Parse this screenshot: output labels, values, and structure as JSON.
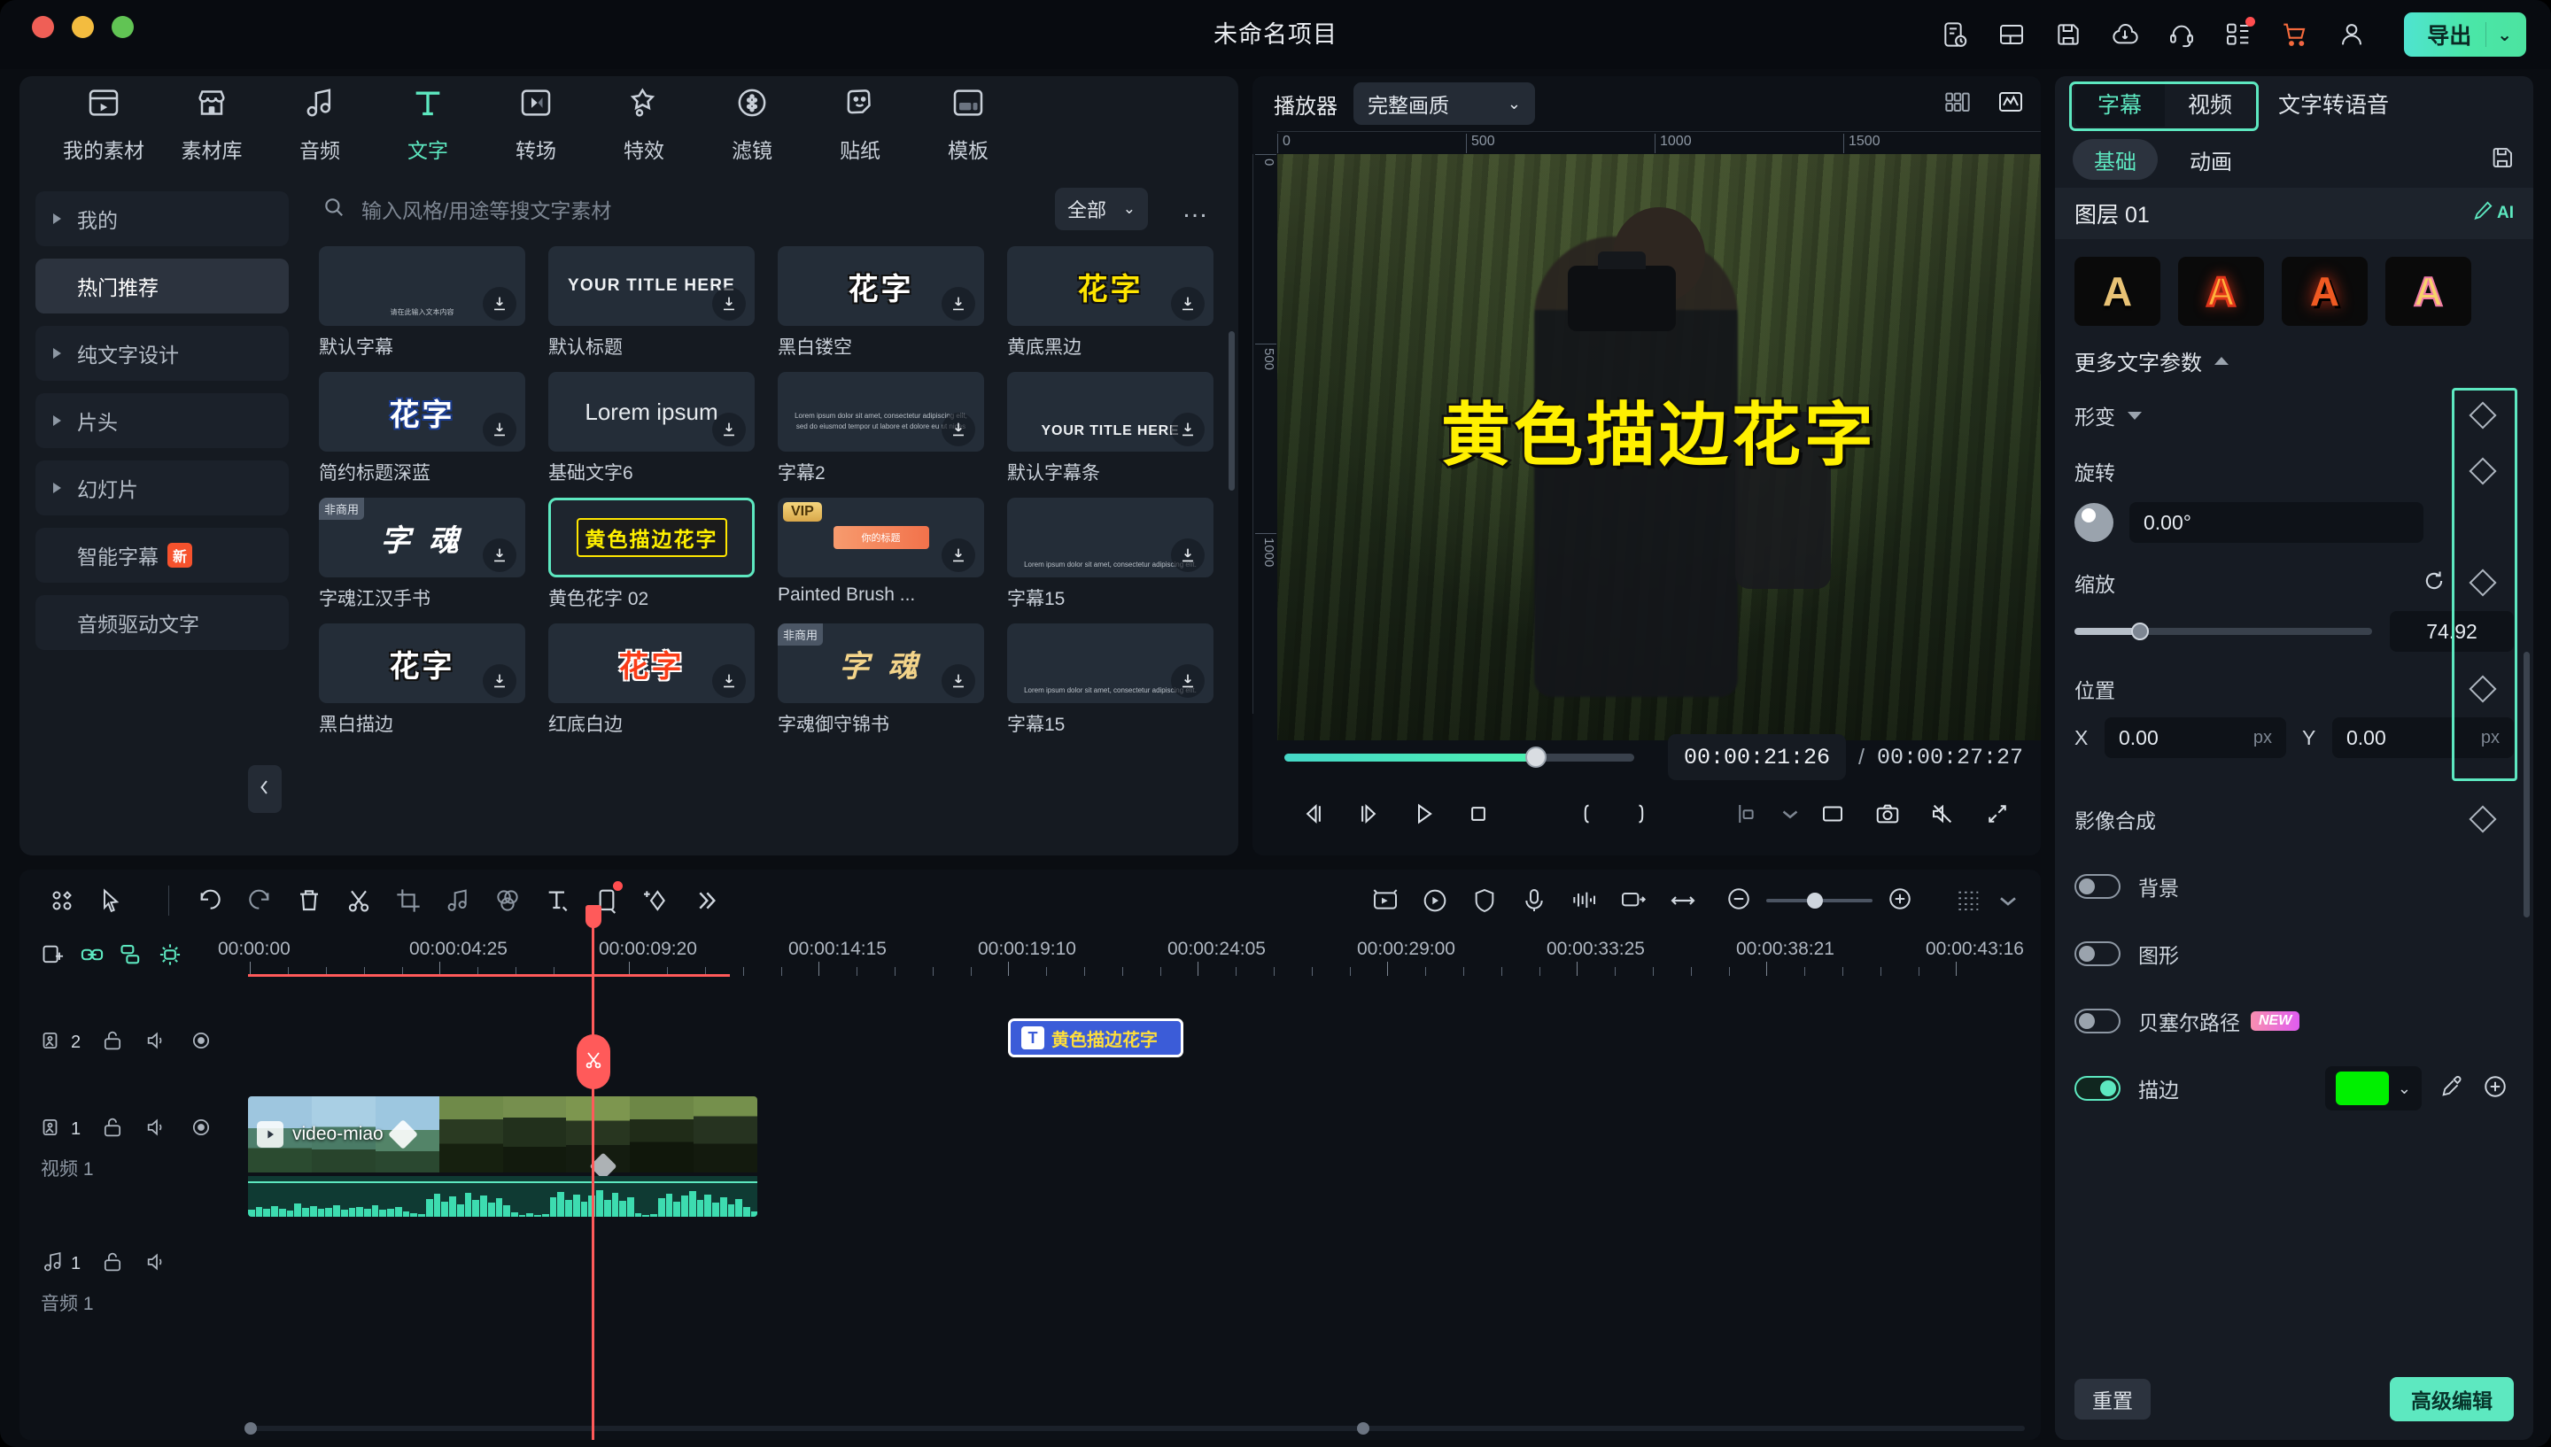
{
  "window": {
    "title": "未命名项目"
  },
  "topbar": {
    "icons": [
      "note-clock-icon",
      "layout-icon",
      "save-icon",
      "cloud-upload-icon",
      "headset-support-icon",
      "apps-grid-icon",
      "cart-icon",
      "account-icon"
    ],
    "export_label": "导出",
    "export_chevron": "chevron-down-icon"
  },
  "material_panel": {
    "tabs": [
      {
        "label": "我的素材",
        "icon": "my-media-icon",
        "active": false
      },
      {
        "label": "素材库",
        "icon": "store-icon",
        "active": false
      },
      {
        "label": "音频",
        "icon": "music-note-icon",
        "active": false
      },
      {
        "label": "文字",
        "icon": "text-t-icon",
        "active": true
      },
      {
        "label": "转场",
        "icon": "transition-icon",
        "active": false
      },
      {
        "label": "特效",
        "icon": "sparkle-star-icon",
        "active": false
      },
      {
        "label": "滤镜",
        "icon": "filter-circle-icon",
        "active": false
      },
      {
        "label": "贴纸",
        "icon": "sticker-smiley-icon",
        "active": false
      },
      {
        "label": "模板",
        "icon": "template-icon",
        "active": false
      }
    ],
    "sidebar": [
      {
        "label": "我的",
        "expandable": true,
        "active": false
      },
      {
        "label": "热门推荐",
        "expandable": false,
        "active": true
      },
      {
        "label": "纯文字设计",
        "expandable": true,
        "active": false
      },
      {
        "label": "片头",
        "expandable": true,
        "active": false
      },
      {
        "label": "幻灯片",
        "expandable": true,
        "active": false
      },
      {
        "label": "智能字幕",
        "expandable": false,
        "active": false,
        "badge": "新"
      },
      {
        "label": "音频驱动文字",
        "expandable": false,
        "active": false
      }
    ],
    "search": {
      "placeholder": "输入风格/用途等搜文字素材",
      "icon": "search-icon"
    },
    "filter": {
      "label": "全部",
      "icon": "chevron-down-icon"
    },
    "more": "…",
    "items": [
      {
        "name": "默认字幕",
        "style": "mini",
        "preview": "请在此输入文本内容"
      },
      {
        "name": "默认标题",
        "style": "title",
        "preview": "YOUR TITLE HERE"
      },
      {
        "name": "黑白镂空",
        "style": "hua-bw",
        "preview": "花字"
      },
      {
        "name": "黄底黑边",
        "style": "hua-y",
        "preview": "花字"
      },
      {
        "name": "简约标题深蓝",
        "style": "hua-b",
        "preview": "花字"
      },
      {
        "name": "基础文字6",
        "style": "lorem",
        "preview": "Lorem ipsum"
      },
      {
        "name": "字幕2",
        "style": "mini-lorem",
        "preview": "Lorem ipsum dolor sit amet, consectetur adipiscing elit, sed do eiusmod tempor ut labore et dolore eu ut nices"
      },
      {
        "name": "默认字幕条",
        "style": "title-sm",
        "preview": "YOUR TITLE HERE"
      },
      {
        "name": "字魂江汉手书",
        "style": "zh-white",
        "preview": "字 魂",
        "tag": "非商用"
      },
      {
        "name": "黄色花字 02",
        "style": "yellow-outline",
        "preview": "黄色描边花字",
        "selected": true
      },
      {
        "name": "Painted Brush ...",
        "style": "brush",
        "preview": "你的标题",
        "tag": "VIP"
      },
      {
        "name": "字幕15",
        "style": "mini-lorem",
        "preview": "Lorem ipsum dolor sit amet, consectetur adipiscing elit."
      },
      {
        "name": "黑白描边",
        "style": "hua-bw",
        "preview": "花字"
      },
      {
        "name": "红底白边",
        "style": "hua-r",
        "preview": "花字"
      },
      {
        "name": "字魂御守锦书",
        "style": "zh-gold",
        "preview": "字 魂",
        "tag": "非商用"
      },
      {
        "name": "字幕15",
        "style": "mini-lorem",
        "preview": "Lorem ipsum dolor sit amet, consectetur adipiscing elit."
      }
    ],
    "collapse_icon": "chevron-left-icon"
  },
  "player": {
    "label": "播放器",
    "quality": "完整画质",
    "quality_icon": "chevron-down-icon",
    "header_icons": [
      "grid-compare-icon",
      "waveform-scope-icon"
    ],
    "ruler_h": [
      "0",
      "500",
      "1000",
      "1500"
    ],
    "ruler_v": [
      "0",
      "500",
      "1000"
    ],
    "overlay_text": "黄色描边花字",
    "current_time": "00:00:21:26",
    "separator": "/",
    "total_time": "00:00:27:27",
    "progress_percent": 72,
    "controls": [
      "prev-frame-icon",
      "next-frame-icon",
      "play-icon",
      "stop-icon",
      "mark-in-icon",
      "mark-out-icon",
      "crop-ratio-icon",
      "chevron-down-icon",
      "fullscreen-window-icon",
      "snapshot-camera-icon",
      "mute-icon",
      "expand-icon"
    ]
  },
  "properties": {
    "tabs": [
      {
        "label": "字幕",
        "active": true
      },
      {
        "label": "视频",
        "active": false
      },
      {
        "label": "文字转语音",
        "active": false
      }
    ],
    "subtabs": [
      {
        "label": "基础",
        "active": true
      },
      {
        "label": "动画",
        "active": false
      }
    ],
    "save_icon": "save-preset-icon",
    "layer_name": "图层 01",
    "ai_label": "AI",
    "ai_icon": "ai-pen-icon",
    "presets": [
      "A",
      "A",
      "A",
      "A"
    ],
    "more_params_label": "更多文字参数",
    "deform_label": "形变",
    "rotate_label": "旋转",
    "rotate_value": "0.00°",
    "scale_label": "缩放",
    "scale_value": "74.92",
    "scale_percent": 22,
    "reset_icon": "reset-circle-icon",
    "position_label": "位置",
    "pos_x_label": "X",
    "pos_x_value": "0.00",
    "pos_x_unit": "px",
    "pos_y_label": "Y",
    "pos_y_value": "0.00",
    "pos_y_unit": "px",
    "compose_label": "影像合成",
    "toggles": [
      {
        "label": "背景",
        "on": false
      },
      {
        "label": "图形",
        "on": false
      },
      {
        "label": "贝塞尔路径",
        "on": false,
        "badge": "NEW"
      },
      {
        "label": "描边",
        "on": true,
        "color": "#00f000"
      }
    ],
    "stroke_color": "#00f000",
    "eyedropper_icon": "eyedropper-icon",
    "add_icon": "plus-circle-icon",
    "reset_button": "重置",
    "advanced_button": "高级编辑",
    "keyframe_icon": "diamond-keyframe-icon"
  },
  "timeline": {
    "toolbar_icons": [
      "four-dots-icon",
      "select-arrow-icon",
      "undo-icon",
      "redo-icon",
      "delete-icon",
      "split-scissors-icon",
      "crop-icon",
      "audio-detach-icon",
      "color-match-icon",
      "text-tool-icon",
      "mask-icon",
      "keyframe-add-icon",
      "chevron-right-more-icon"
    ],
    "toolbar_right_icons": [
      "smart-cutout-icon",
      "record-icon",
      "shield-icon",
      "mic-icon",
      "audio-track-icon",
      "stabilize-icon",
      "fit-width-icon"
    ],
    "zoom_out_icon": "minus-circle-icon",
    "zoom_in_icon": "plus-circle-icon",
    "grid_icon": "grid-view-icon",
    "grid_chevron": "chevron-down-icon",
    "head_icons": [
      "add-track-icon",
      "link-icon",
      "group-icon",
      "auto-snap-icon"
    ],
    "ruler_labels": [
      "00:00:00",
      "00:00:04:25",
      "00:00:09:20",
      "00:00:14:15",
      "00:00:19:10",
      "00:00:24:05",
      "00:00:29:00",
      "00:00:33:25",
      "00:00:38:21",
      "00:00:43:16"
    ],
    "split_icon": "scissors-icon",
    "tracks": [
      {
        "type": "video",
        "number": "2",
        "name": "",
        "icons": [
          "track-video-icon",
          "lock-icon",
          "volume-icon",
          "eye-icon"
        ]
      },
      {
        "type": "video",
        "number": "1",
        "name": "视频 1",
        "icons": [
          "track-video-icon",
          "lock-icon",
          "volume-icon",
          "eye-icon"
        ]
      },
      {
        "type": "audio",
        "number": "1",
        "name": "音频 1",
        "icons": [
          "track-audio-icon",
          "lock-icon",
          "volume-icon"
        ]
      }
    ],
    "text_clip": {
      "label": "黄色描边花字",
      "icon": "text-badge-icon"
    },
    "video_clip": {
      "label": "video-miao",
      "play_icon": "play-small-icon",
      "keyframe_icon": "diamond-icon"
    }
  }
}
